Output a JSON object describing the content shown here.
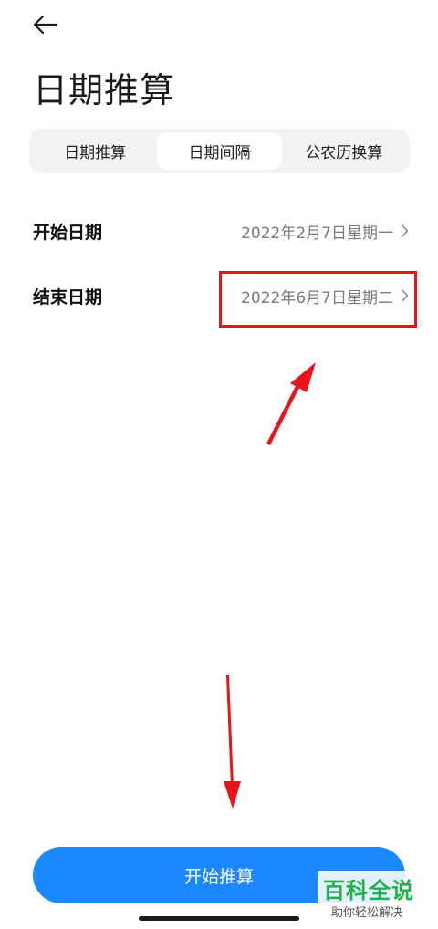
{
  "header": {
    "title": "日期推算"
  },
  "tabs": [
    {
      "label": "日期推算",
      "active": false
    },
    {
      "label": "日期间隔",
      "active": true
    },
    {
      "label": "公农历换算",
      "active": false
    }
  ],
  "rows": {
    "start": {
      "label": "开始日期",
      "value": "2022年2月7日星期一"
    },
    "end": {
      "label": "结束日期",
      "value": "2022年6月7日星期二"
    }
  },
  "action": {
    "label": "开始推算"
  },
  "watermark": {
    "main": "百科全说",
    "sub": "助你轻松解决"
  },
  "colors": {
    "primary": "#1b88ff",
    "annotation": "#e8131b",
    "watermark": "#21b14a"
  },
  "icons": {
    "back": "arrow-left-icon",
    "chevron": "chevron-right-icon"
  }
}
